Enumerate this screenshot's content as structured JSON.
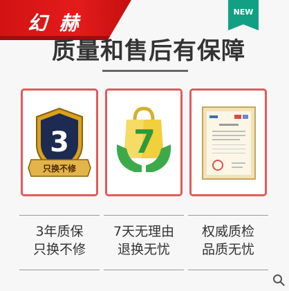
{
  "brand": {
    "name": "幻 赫"
  },
  "badge": {
    "label": "NEW"
  },
  "headline": "质量和售后有保障",
  "cards": [
    {
      "icon": "shield-icon",
      "number": "3",
      "banner": "只换不修"
    },
    {
      "icon": "shopping-bag-hands-icon",
      "number": "7"
    },
    {
      "icon": "certificate-document-icon"
    }
  ],
  "captions": [
    {
      "line1": "3年质保",
      "line2": "只换不修"
    },
    {
      "line1": "7天无理由",
      "line2": "退换无忧"
    },
    {
      "line1": "权威质检",
      "line2": "品质无忧"
    }
  ],
  "colors": {
    "ribbon": "#d21313",
    "badge": "#12a084",
    "card_border": "#e05a5a",
    "shield_navy": "#1d2a52",
    "gold": "#d9a21e",
    "hands_green": "#3daa4a",
    "bag_yellow": "#f2cf3d"
  }
}
